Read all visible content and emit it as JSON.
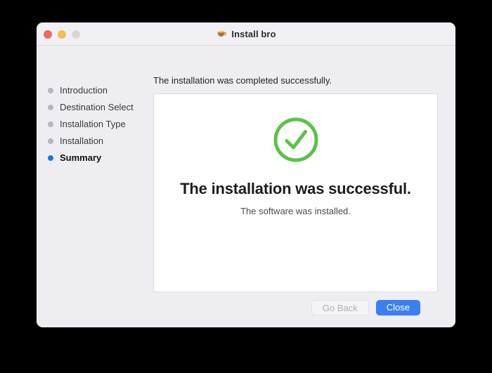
{
  "window": {
    "title": "Install bro",
    "app_icon": "beer-mug-icon",
    "traffic_lights": [
      {
        "name": "close",
        "label": "Close window",
        "color": "#ec6a5f"
      },
      {
        "name": "minimize",
        "label": "Minimize window",
        "color": "#f4bd4f"
      },
      {
        "name": "zoom",
        "label": "Zoom window",
        "color": "#d6d6d9"
      }
    ]
  },
  "sidebar": {
    "steps": [
      {
        "label": "Introduction",
        "active": false
      },
      {
        "label": "Destination Select",
        "active": false
      },
      {
        "label": "Installation Type",
        "active": false
      },
      {
        "label": "Installation",
        "active": false
      },
      {
        "label": "Summary",
        "active": true
      }
    ],
    "dot_color_inactive": "#b6b6bd",
    "dot_color_active": "#1478ef"
  },
  "main": {
    "heading": "The installation was completed successfully.",
    "success_icon": "check-circle-icon",
    "success_icon_color": "#5cc148",
    "title": "The installation was successful.",
    "subtitle": "The software was installed."
  },
  "footer": {
    "go_back_label": "Go Back",
    "close_label": "Close",
    "close_button_color": "#3c7ff0"
  }
}
